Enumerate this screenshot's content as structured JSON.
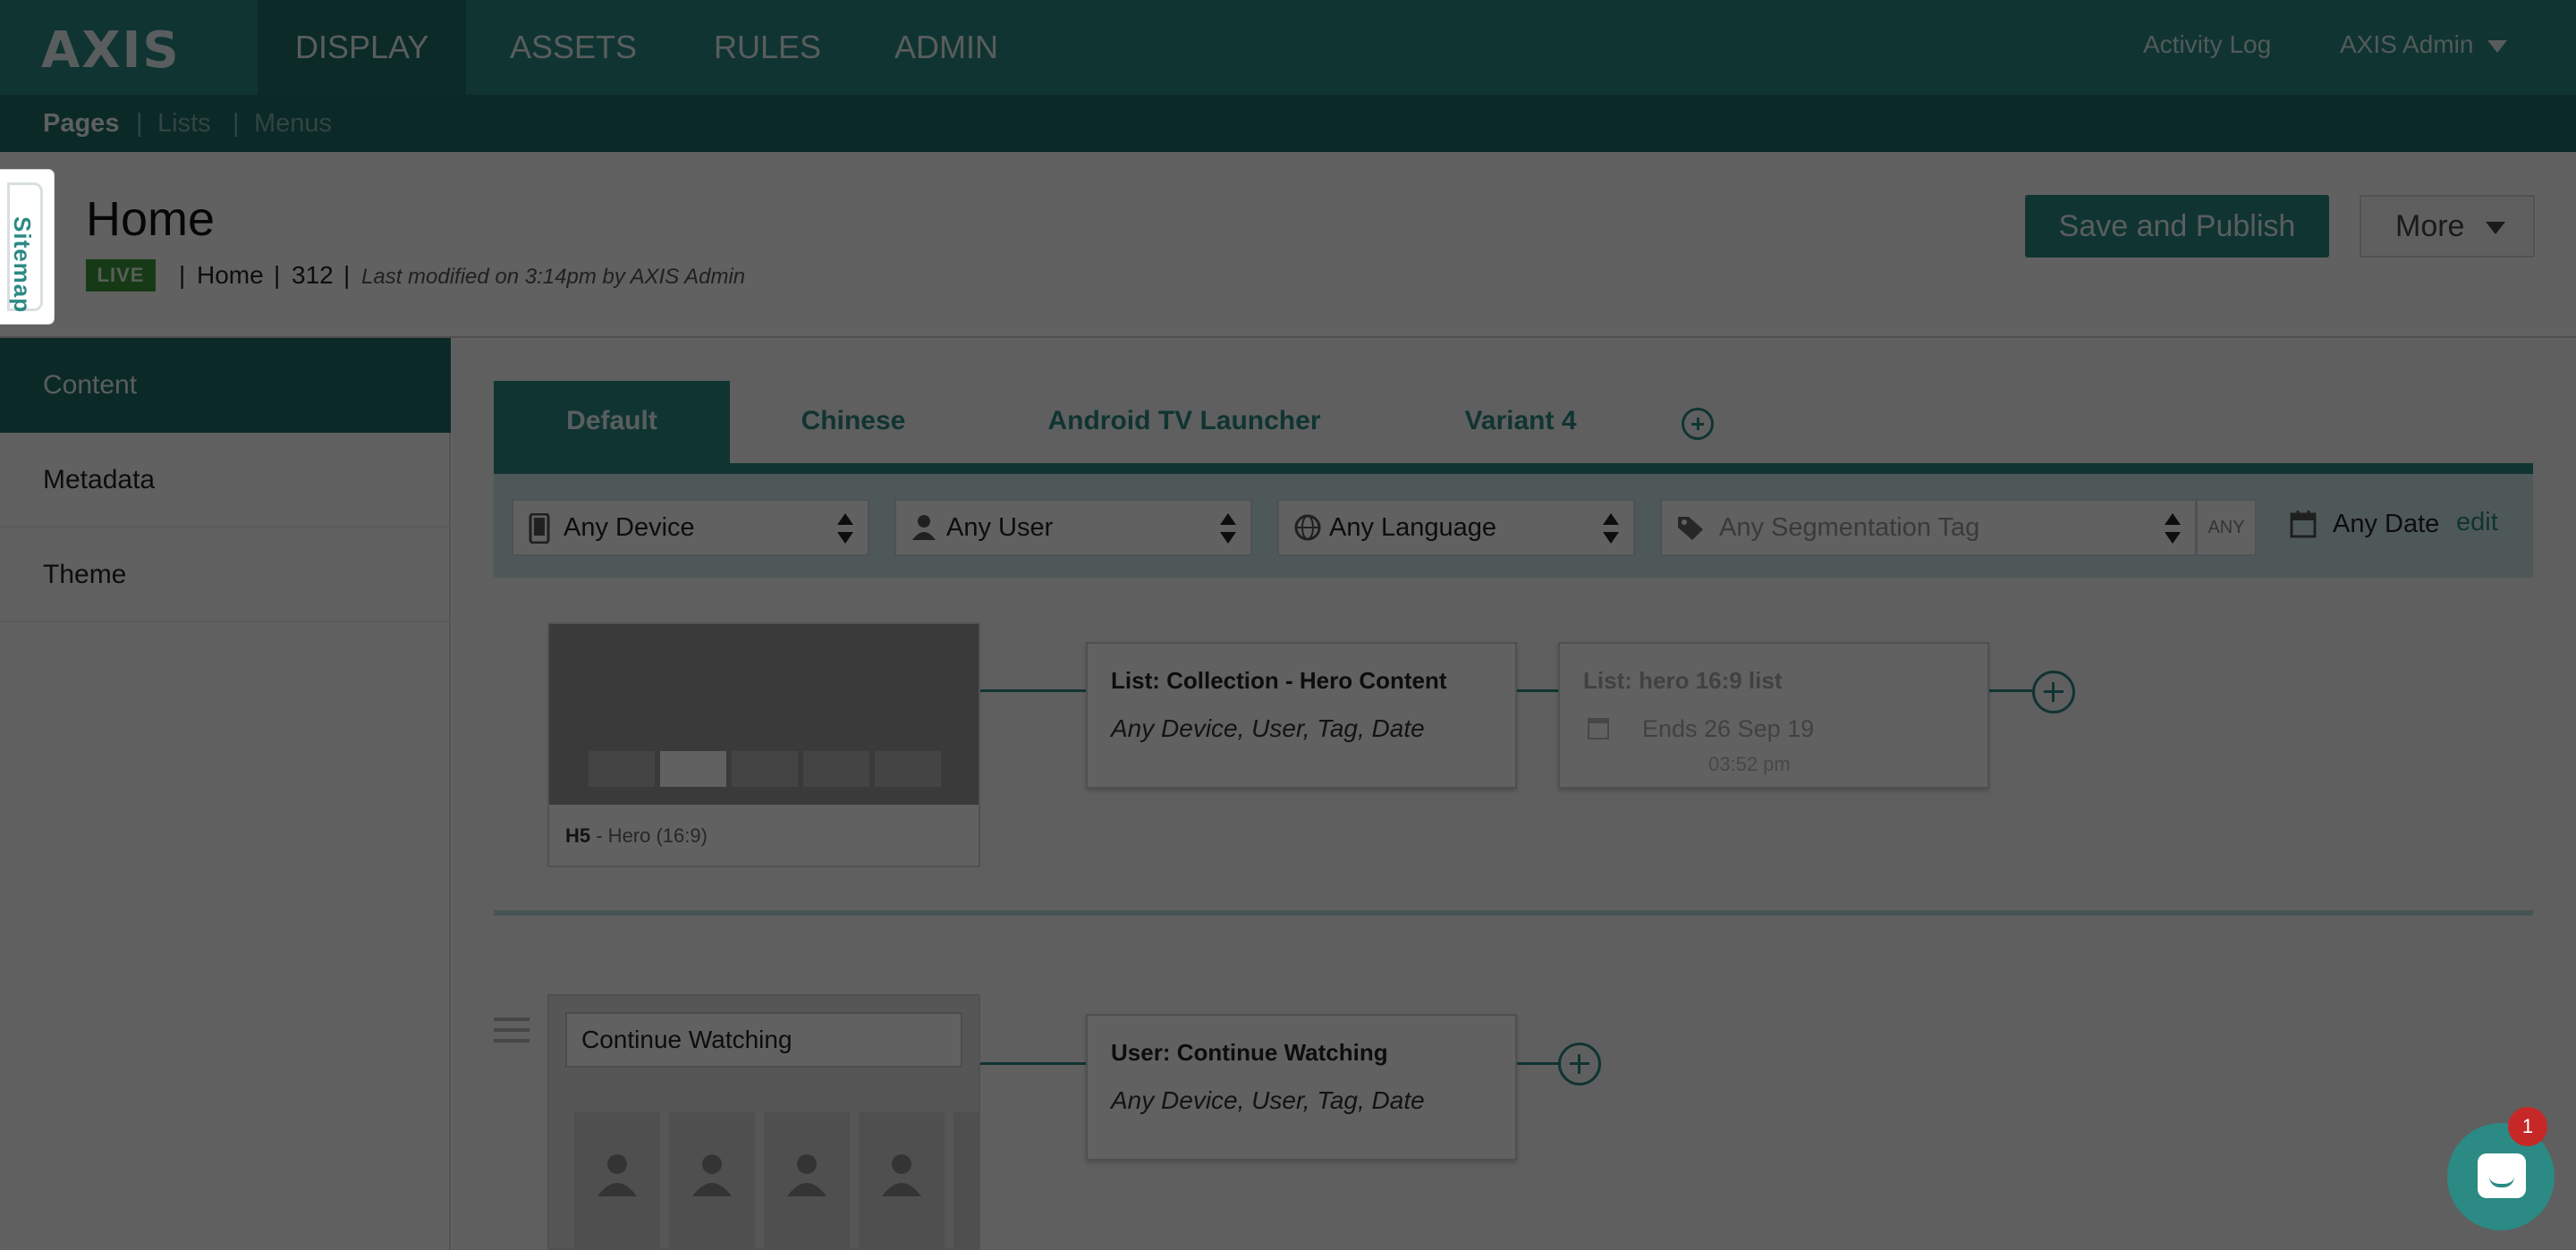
{
  "app": {
    "logo": "AXIS",
    "nav": [
      {
        "label": "DISPLAY",
        "active": true
      },
      {
        "label": "ASSETS",
        "active": false
      },
      {
        "label": "RULES",
        "active": false
      },
      {
        "label": "ADMIN",
        "active": false
      }
    ],
    "activity_log": "Activity Log",
    "user_menu": "AXIS Admin"
  },
  "subnav": {
    "pages": "Pages",
    "lists": "Lists",
    "menus": "Menus",
    "sep": "|"
  },
  "sitemap_tab": "Sitemap",
  "page": {
    "title": "Home",
    "status": "LIVE",
    "path_name": "Home",
    "page_id": "312",
    "sep": "|",
    "modified": "Last modified on 3:14pm by AXIS Admin",
    "save_publish": "Save and Publish",
    "more": "More"
  },
  "side_menu": [
    {
      "label": "Content",
      "active": true
    },
    {
      "label": "Metadata",
      "active": false
    },
    {
      "label": "Theme",
      "active": false
    }
  ],
  "variant_tabs": [
    {
      "label": "Default",
      "active": true
    },
    {
      "label": "Chinese",
      "active": false
    },
    {
      "label": "Android TV Launcher",
      "active": false
    },
    {
      "label": "Variant 4",
      "active": false
    }
  ],
  "filters": {
    "device": "Any Device",
    "user": "Any User",
    "language": "Any Language",
    "segmentation_placeholder": "Any Segmentation Tag",
    "any_toggle": "ANY",
    "date": "Any Date",
    "edit": "edit"
  },
  "rows": {
    "hero": {
      "code": "H5",
      "label": " - Hero (16:9)",
      "list_title": "List: Collection - Hero Content",
      "list_targets": "Any Device, User, Tag, Date",
      "scheduled_title": "List: hero 16:9 list",
      "scheduled_ends": "Ends  26 Sep 19",
      "scheduled_time": "03:52 pm"
    },
    "continue_watching": {
      "title_value": "Continue Watching",
      "list_title": "User: Continue Watching",
      "list_targets": "Any Device, User, Tag, Date"
    }
  },
  "chat": {
    "badge": "1"
  },
  "colors": {
    "brand": "#2b8a84",
    "brand_dark": "#1e6c67",
    "live": "#3c9a3a",
    "badge": "#c62828"
  },
  "icons": [
    "phone-icon",
    "user-icon",
    "globe-icon",
    "tag-icon",
    "calendar-icon",
    "plus-circle-icon",
    "chat-icon",
    "drag-handle-icon",
    "caret-down-icon"
  ]
}
